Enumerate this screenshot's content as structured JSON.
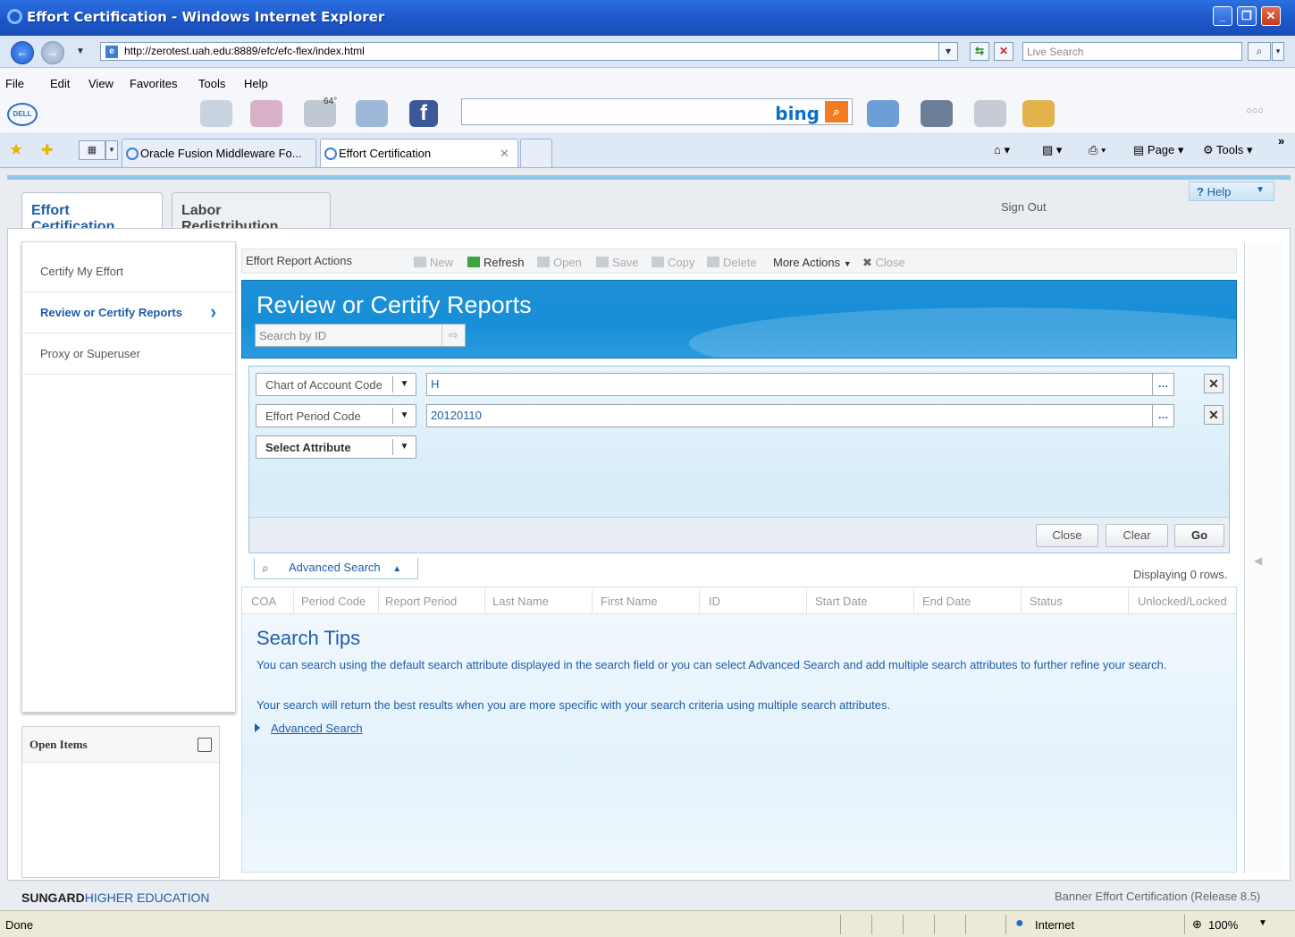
{
  "window": {
    "title": "Effort Certification - Windows Internet Explorer"
  },
  "browser": {
    "url": "http://zerotest.uah.edu:8889/efc/efc-flex/index.html",
    "live_search_placeholder": "Live Search",
    "menu": [
      "File",
      "Edit",
      "View",
      "Favorites",
      "Tools",
      "Help"
    ],
    "weather": "64°",
    "dell_logo": "DELL",
    "bing_label": "bing",
    "tabs": [
      {
        "label": "Oracle Fusion Middleware Fo..."
      },
      {
        "label": "Effort Certification"
      }
    ],
    "page_menu": "Page",
    "tools_menu": "Tools",
    "status_text": "Done",
    "zone": "Internet",
    "zoom": "100%"
  },
  "app": {
    "tabs": [
      {
        "label": "Effort Certification"
      },
      {
        "label": "Labor Redistribution"
      }
    ],
    "help_label": "Help",
    "sign_out_label": "Sign Out",
    "nav": [
      {
        "label": "Certify My Effort"
      },
      {
        "label": "Review or Certify Reports"
      },
      {
        "label": "Proxy or Superuser"
      }
    ],
    "open_items_title": "Open Items",
    "action_bar": {
      "label": "Effort Report Actions",
      "new": "New",
      "refresh": "Refresh",
      "open": "Open",
      "save": "Save",
      "copy": "Copy",
      "delete": "Delete",
      "more_actions": "More Actions",
      "close": "Close"
    },
    "page_title": "Review or Certify Reports",
    "search_by_id_placeholder": "Search by ID",
    "criteria": [
      {
        "attribute": "Chart of Account Code",
        "value": "H"
      },
      {
        "attribute": "Effort Period Code",
        "value": "20120110"
      }
    ],
    "select_attribute_label": "Select Attribute",
    "buttons": {
      "close": "Close",
      "clear": "Clear",
      "go": "Go"
    },
    "advanced_search_label": "Advanced Search",
    "row_count": "Displaying 0 rows.",
    "columns": [
      "COA",
      "Period Code",
      "Report Period",
      "Last Name",
      "First Name",
      "ID",
      "Start Date",
      "End Date",
      "Status",
      "Unlocked/Locked"
    ],
    "search_tips": {
      "title": "Search Tips",
      "line1": "You can search using the default search attribute displayed in the search field or you can select Advanced Search and add multiple search attributes to further refine your search.",
      "line2": "Your search will return the best results when you are more specific with your search criteria using multiple search attributes.",
      "link": "Advanced Search"
    },
    "footer": {
      "brand": "SUNGARD",
      "brand_sub": "HIGHER EDUCATION",
      "release": "Banner Effort Certification (Release 8.5)"
    }
  }
}
